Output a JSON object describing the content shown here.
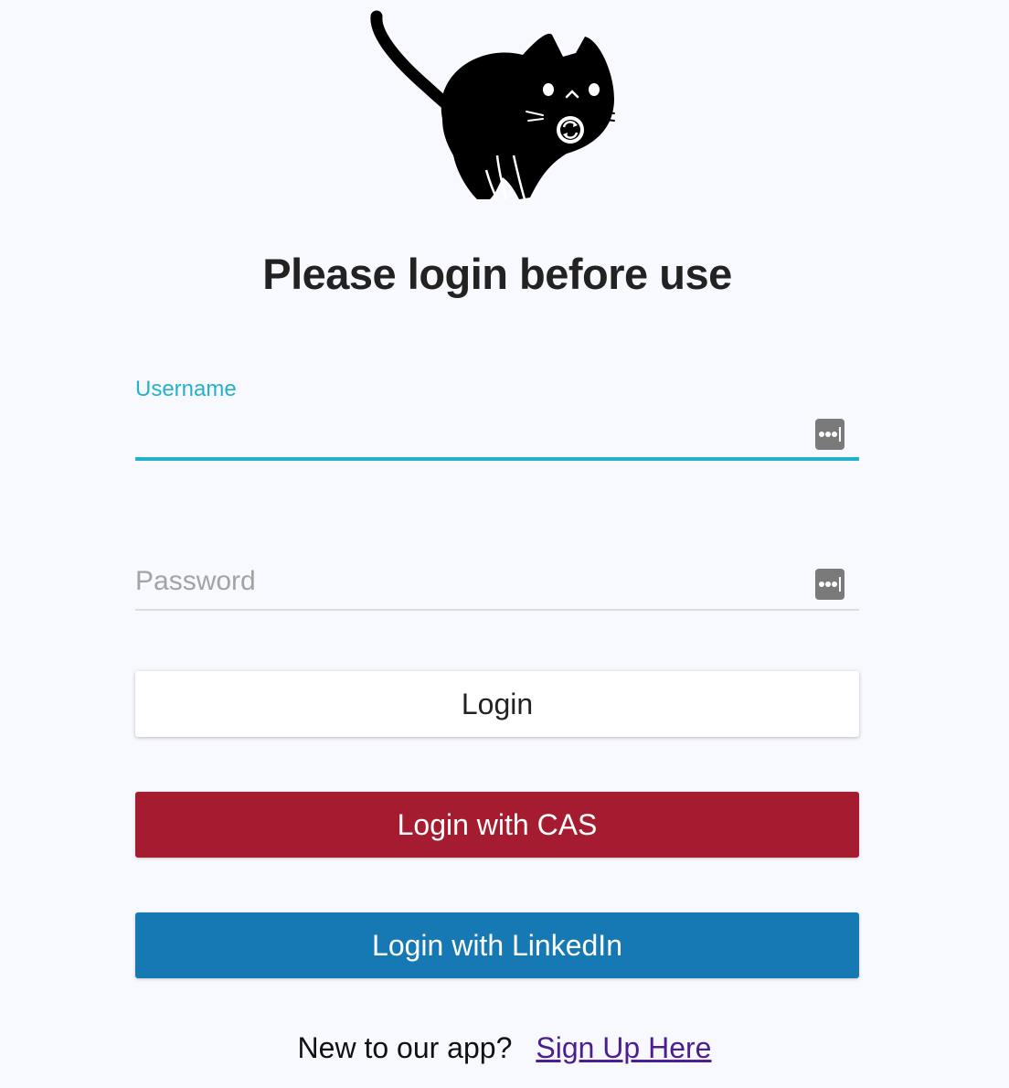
{
  "logo": {
    "icon": "cat-sync-logo-icon"
  },
  "page_title": "Please login before use",
  "username": {
    "label": "Username",
    "value": "",
    "icon": "password-manager-icon"
  },
  "password": {
    "placeholder": "Password",
    "value": "",
    "icon": "password-manager-icon"
  },
  "buttons": {
    "login": "Login",
    "cas": "Login with CAS",
    "linkedin": "Login with LinkedIn"
  },
  "signup": {
    "prompt": "New to our app?",
    "link": "Sign Up Here"
  },
  "colors": {
    "accent": "#26b1cb",
    "cas": "#a51c30",
    "linkedin": "#1679b4",
    "link": "#4b1f91",
    "background": "#f8f9fe"
  }
}
